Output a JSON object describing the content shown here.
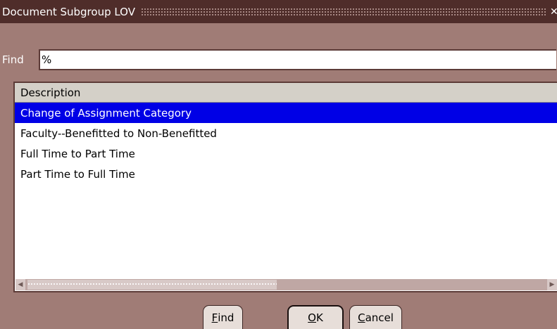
{
  "window": {
    "title": "Document Subgroup LOV"
  },
  "find": {
    "label": "Find",
    "value": "%"
  },
  "list": {
    "header": "Description",
    "rows": [
      "Change of Assignment Category",
      "Faculty--Benefitted to Non-Benefitted",
      "Full Time to Part Time",
      "Part Time to Full Time"
    ],
    "selected_index": 0
  },
  "buttons": {
    "find": {
      "mnemonic": "F",
      "rest": "ind"
    },
    "ok": {
      "mnemonic": "O",
      "rest": "K"
    },
    "cancel": {
      "mnemonic": "C",
      "rest": "ancel"
    }
  },
  "colors": {
    "background": "#a07c76",
    "titlebar": "#4f2d2a",
    "selection": "#0000e6"
  }
}
